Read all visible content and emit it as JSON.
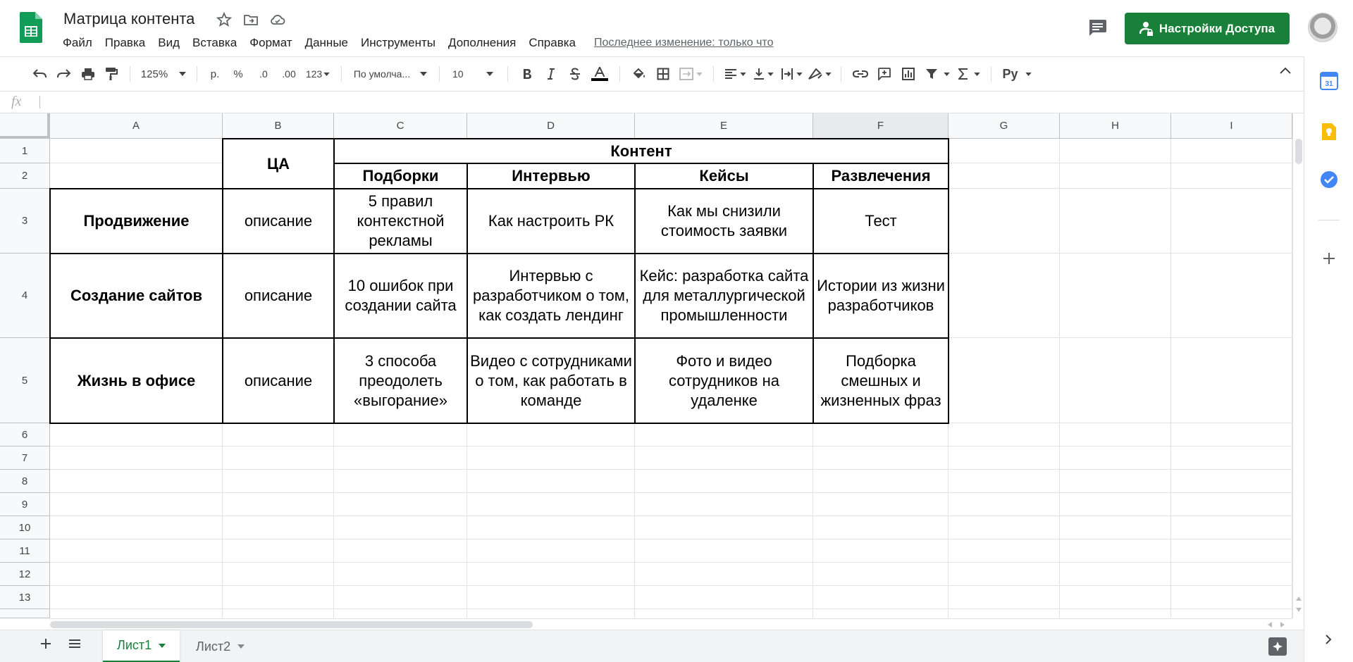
{
  "app": {
    "doc_title": "Матрица контента",
    "last_edit": "Последнее изменение: только что",
    "share_label": "Настройки Доступа"
  },
  "menu": [
    "Файл",
    "Правка",
    "Вид",
    "Вставка",
    "Формат",
    "Данные",
    "Инструменты",
    "Дополнения",
    "Справка"
  ],
  "toolbar": {
    "zoom": "125%",
    "currency": "р.",
    "percent": "%",
    "dec_less": ".0",
    "dec_more": ".00",
    "more_formats": "123",
    "font": "По умолча...",
    "font_size": "10",
    "text_color": "#000000",
    "input_tools": "Pу"
  },
  "formula_bar": {
    "fx": "fx",
    "value": ""
  },
  "grid": {
    "columns": [
      "A",
      "B",
      "C",
      "D",
      "E",
      "F",
      "G",
      "H",
      "I"
    ],
    "selected_column": "F",
    "rows": [
      "1",
      "2",
      "3",
      "4",
      "5",
      "6",
      "7",
      "8",
      "9",
      "10",
      "11",
      "12",
      "13"
    ]
  },
  "table": {
    "audience_header": "ЦА",
    "content_header": "Контент",
    "subheaders": [
      "Подборки",
      "Интервью",
      "Кейсы",
      "Развлечения"
    ],
    "rows": [
      {
        "label": "Продвижение",
        "audience": "описание",
        "cells": [
          "5 правил контекстной рекламы",
          "Как настроить РК",
          "Как мы снизили стоимость заявки",
          "Тест"
        ]
      },
      {
        "label": "Создание сайтов",
        "audience": "описание",
        "cells": [
          "10 ошибок при создании сайта",
          "Интервью с разработчиком о том, как создать лендинг",
          "Кейс: разработка сайта для металлургической промышленности",
          "Истории из жизни разработчиков"
        ]
      },
      {
        "label": "Жизнь в офисе",
        "audience": "описание",
        "cells": [
          "3 способа преодолеть «выгорание»",
          "Видео с сотрудниками о том, как работать в команде",
          "Фото и видео сотрудников на удаленке",
          "Подборка смешных и жизненных фраз"
        ]
      }
    ]
  },
  "sheets": [
    {
      "name": "Лист1",
      "active": true
    },
    {
      "name": "Лист2",
      "active": false
    }
  ],
  "colors": {
    "brand_green": "#188038",
    "grid_line": "#e2e2e2",
    "header_bg": "#f8f9fa"
  },
  "side_panel": [
    "calendar-icon",
    "keep-icon",
    "tasks-icon",
    "add-icon"
  ]
}
